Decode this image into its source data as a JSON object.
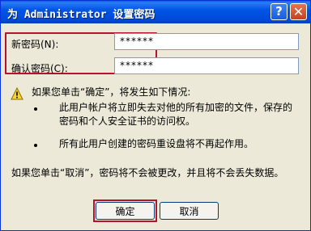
{
  "window": {
    "title": "为 Administrator 设置密码"
  },
  "titlebar": {
    "help_label": "?",
    "close_label": "✕"
  },
  "form": {
    "new_password_label": "新密码(N):",
    "new_password_value": "******",
    "confirm_password_label": "确认密码(C):",
    "confirm_password_value": "******"
  },
  "info": {
    "warning_text": "如果您单击“确定”，将发生如下情况:",
    "bullets": [
      "此用户帐户将立即失去对他的所有加密的文件，保存的密码和个人安全证书的访问权。",
      "所有此用户创建的密码重设盘将不再起作用。"
    ],
    "cancel_note": "如果您单击“取消”，密码将不会被更改，并且将不会丢失数据。"
  },
  "buttons": {
    "ok_label": "确定",
    "cancel_label": "取消"
  }
}
